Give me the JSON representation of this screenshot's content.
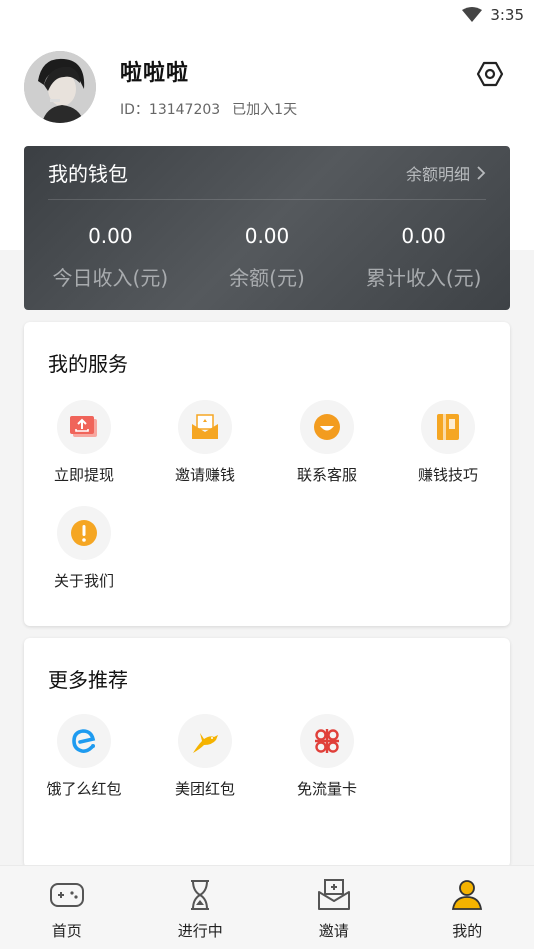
{
  "status_bar": {
    "time": "3:35"
  },
  "profile": {
    "nickname": "啦啦啦",
    "id_text": "ID：13147203",
    "joined_text": "已加入1天"
  },
  "wallet": {
    "title": "我的钱包",
    "detail_link": "余额明细",
    "stats": [
      {
        "value": "0.00",
        "label": "今日收入(元)"
      },
      {
        "value": "0.00",
        "label": "余额(元)"
      },
      {
        "value": "0.00",
        "label": "累计收入(元)"
      }
    ]
  },
  "services": {
    "title": "我的服务",
    "items": [
      {
        "label": "立即提现",
        "icon": "withdraw-icon",
        "color": "#f0645a"
      },
      {
        "label": "邀请赚钱",
        "icon": "invite-envelope-icon",
        "color": "#f5a623"
      },
      {
        "label": "联系客服",
        "icon": "customer-service-icon",
        "color": "#f39c1f"
      },
      {
        "label": "赚钱技巧",
        "icon": "book-icon",
        "color": "#f5a623"
      },
      {
        "label": "关于我们",
        "icon": "info-icon",
        "color": "#f5a623"
      }
    ]
  },
  "recommend": {
    "title": "更多推荐",
    "items": [
      {
        "label": "饿了么红包",
        "icon": "eleme-icon",
        "color": "#1e9bf0"
      },
      {
        "label": "美团红包",
        "icon": "meituan-kangaroo-icon",
        "color": "#f5b300"
      },
      {
        "label": "免流量卡",
        "icon": "unicom-icon",
        "color": "#e0403a"
      }
    ]
  },
  "bottom_nav": [
    {
      "label": "首页",
      "icon": "gamepad-icon"
    },
    {
      "label": "进行中",
      "icon": "hourglass-icon"
    },
    {
      "label": "邀请",
      "icon": "invite-tray-icon"
    },
    {
      "label": "我的",
      "icon": "user-icon",
      "active": true
    }
  ],
  "colors": {
    "accent": "#f5b300",
    "wallet_bg": "#45494d"
  }
}
